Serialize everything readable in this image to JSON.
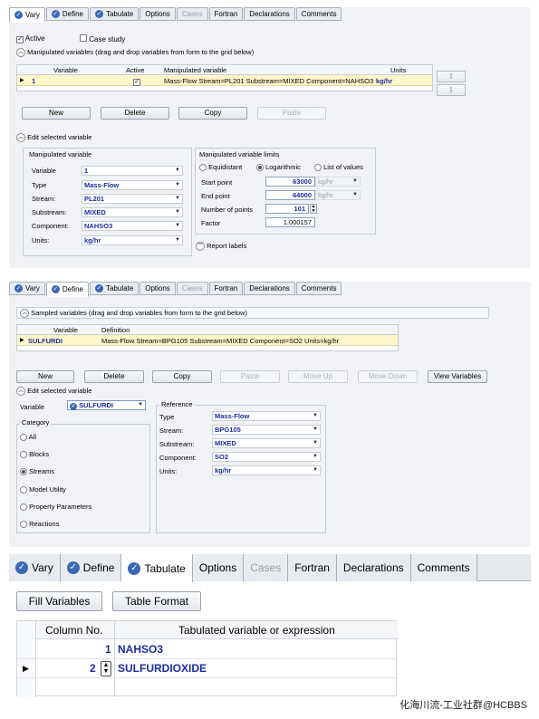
{
  "panel1": {
    "tabs": [
      {
        "label": "Vary",
        "icon": "check-icon",
        "selected": true,
        "disabled": false
      },
      {
        "label": "Define",
        "icon": "check-icon",
        "selected": false,
        "disabled": false
      },
      {
        "label": "Tabulate",
        "icon": "check-icon",
        "selected": false,
        "disabled": false
      },
      {
        "label": "Options",
        "icon": "",
        "selected": false,
        "disabled": false
      },
      {
        "label": "Cases",
        "icon": "",
        "selected": false,
        "disabled": true
      },
      {
        "label": "Fortran",
        "icon": "",
        "selected": false,
        "disabled": false
      },
      {
        "label": "Declarations",
        "icon": "",
        "selected": false,
        "disabled": false
      },
      {
        "label": "Comments",
        "icon": "",
        "selected": false,
        "disabled": false
      }
    ],
    "active_label": "Active",
    "case_study_label": "Case study",
    "manip_header": "Manipulated variables (drag and drop variables from form to the grid below)",
    "grid_headers": {
      "variable": "Variable",
      "active": "Active",
      "manipulated": "Manipulated variable",
      "units": "Units"
    },
    "grid_row": {
      "variable": "1",
      "manipulated": "Mass-Flow Stream=PL201 Substream=MIXED Component=NAHSO3",
      "units": "kg/hr"
    },
    "buttons": {
      "new": "New",
      "delete": "Delete",
      "copy": "Copy",
      "paste": "Paste"
    },
    "edit_header": "Edit selected variable",
    "manip_group_title": "Manipulated variable",
    "fields": [
      {
        "label": "Variable",
        "value": "1"
      },
      {
        "label": "Type",
        "value": "Mass-Flow"
      },
      {
        "label": "Stream:",
        "value": "PL201"
      },
      {
        "label": "Substream:",
        "value": "MIXED"
      },
      {
        "label": "Component:",
        "value": "NAHSO3"
      },
      {
        "label": "Units:",
        "value": "kg/hr"
      }
    ],
    "limits_title": "Manipulated variable limits",
    "radios": {
      "equidistant": "Equidistant",
      "log": "Logarithmic",
      "list": "List of values"
    },
    "start_label": "Start point",
    "start_value": "63000",
    "start_unit": "kg/hr",
    "end_label": "End point",
    "end_value": "64000",
    "end_unit": "kg/hr",
    "npoints_label": "Number of points",
    "npoints_value": "101",
    "factor_label": "Factor",
    "factor_value": "1.000157",
    "report_labels": "Report labels"
  },
  "panel2": {
    "tabs": [
      {
        "label": "Vary",
        "selected": false,
        "disabled": false,
        "icon": "check-icon"
      },
      {
        "label": "Define",
        "selected": true,
        "disabled": false,
        "icon": "check-icon"
      },
      {
        "label": "Tabulate",
        "selected": false,
        "disabled": false,
        "icon": "check-icon"
      },
      {
        "label": "Options",
        "selected": false,
        "disabled": false,
        "icon": ""
      },
      {
        "label": "Cases",
        "selected": false,
        "disabled": true,
        "icon": ""
      },
      {
        "label": "Fortran",
        "selected": false,
        "disabled": false,
        "icon": ""
      },
      {
        "label": "Declarations",
        "selected": false,
        "disabled": false,
        "icon": ""
      },
      {
        "label": "Comments",
        "selected": false,
        "disabled": false,
        "icon": ""
      }
    ],
    "sampled_header": "Sampled variables (drag and drop variables from form to the grid below)",
    "grid_headers": {
      "variable": "Variable",
      "definition": "Definition"
    },
    "grid_row": {
      "variable": "SULFURDI",
      "definition": "Mass-Flow Stream=BPG105 Substream=MIXED Component=SO2 Units=kg/hr"
    },
    "buttons": {
      "new": "New",
      "delete": "Delete",
      "copy": "Copy",
      "paste": "Paste",
      "move_up": "Move Up",
      "move_down": "Move Down",
      "view": "View Variables"
    },
    "edit_header": "Edit selected variable",
    "variable_label": "Variable",
    "variable_value": "SULFURDI",
    "category_title": "Category",
    "categories": [
      {
        "label": "All",
        "on": false
      },
      {
        "label": "Blocks",
        "on": false
      },
      {
        "label": "Streams",
        "on": true
      },
      {
        "label": "Model Utility",
        "on": false
      },
      {
        "label": "Property Parameters",
        "on": false
      },
      {
        "label": "Reactions",
        "on": false
      }
    ],
    "reference_title": "Reference",
    "ref_fields": [
      {
        "label": "Type",
        "value": "Mass-Flow"
      },
      {
        "label": "Stream:",
        "value": "BPG105"
      },
      {
        "label": "Substream:",
        "value": "MIXED"
      },
      {
        "label": "Component:",
        "value": "SO2"
      },
      {
        "label": "Units:",
        "value": "kg/hr"
      }
    ]
  },
  "panel3": {
    "tabs": [
      {
        "label": "Vary",
        "selected": false,
        "disabled": false,
        "icon": "check-icon"
      },
      {
        "label": "Define",
        "selected": false,
        "disabled": false,
        "icon": "check-icon"
      },
      {
        "label": "Tabulate",
        "selected": true,
        "disabled": false,
        "icon": "check-icon"
      },
      {
        "label": "Options",
        "selected": false,
        "disabled": false,
        "icon": ""
      },
      {
        "label": "Cases",
        "selected": false,
        "disabled": true,
        "icon": ""
      },
      {
        "label": "Fortran",
        "selected": false,
        "disabled": false,
        "icon": ""
      },
      {
        "label": "Declarations",
        "selected": false,
        "disabled": false,
        "icon": ""
      },
      {
        "label": "Comments",
        "selected": false,
        "disabled": false,
        "icon": ""
      }
    ],
    "fill_button": "Fill Variables",
    "format_button": "Table Format",
    "grid_headers": {
      "col": "Column No.",
      "expr": "Tabulated variable or expression"
    },
    "rows": [
      {
        "col": "1",
        "expr": "NAHSO3"
      },
      {
        "col": "2",
        "expr": "SULFURDIOXIDE"
      }
    ]
  },
  "watermark": "化海川流-工业社群@HCBBS"
}
